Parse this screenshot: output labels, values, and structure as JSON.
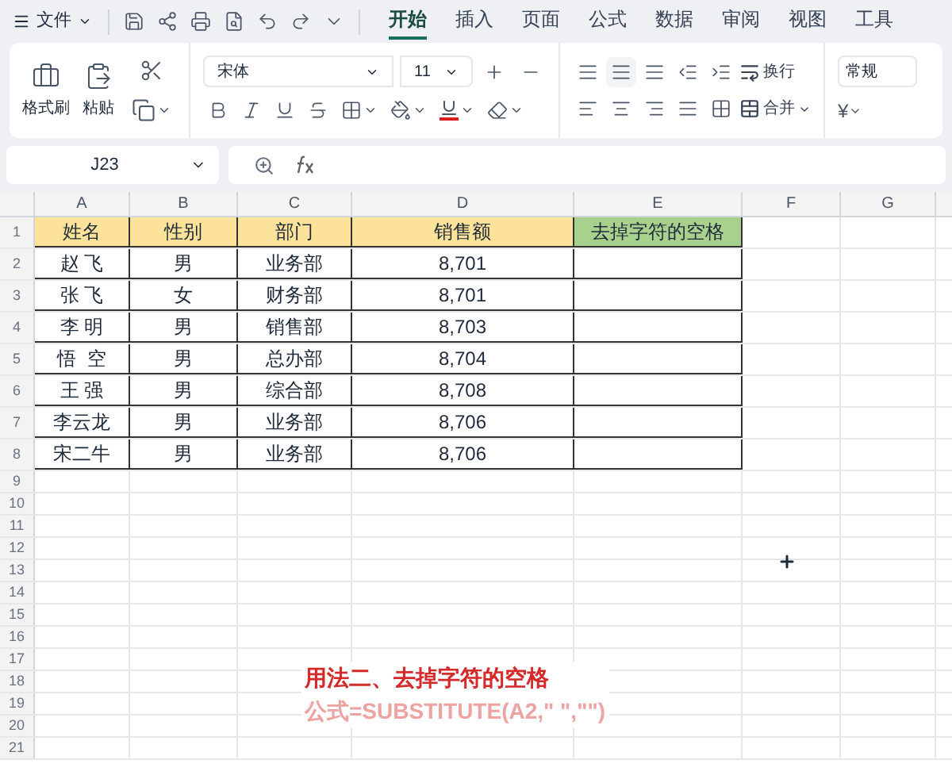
{
  "menu": {
    "file_label": "文件",
    "tabs": [
      {
        "label": "开始",
        "selected": true
      },
      {
        "label": "插入",
        "selected": false
      },
      {
        "label": "页面",
        "selected": false
      },
      {
        "label": "公式",
        "selected": false
      },
      {
        "label": "数据",
        "selected": false
      },
      {
        "label": "审阅",
        "selected": false
      },
      {
        "label": "视图",
        "selected": false
      },
      {
        "label": "工具",
        "selected": false
      }
    ]
  },
  "ribbon": {
    "format_painter": "格式刷",
    "paste": "粘贴",
    "font_name": "宋体",
    "font_size": "11",
    "wrap": "换行",
    "merge": "合并",
    "number_format": "常规",
    "currency_symbol": "¥"
  },
  "formula_bar": {
    "cell_ref": "J23"
  },
  "sheet": {
    "columns": [
      "A",
      "B",
      "C",
      "D",
      "E",
      "F",
      "G"
    ],
    "header": [
      "姓名",
      "性别",
      "部门",
      "销售额",
      "去掉字符的空格"
    ],
    "rows": [
      [
        "赵 飞",
        "男",
        "业务部",
        "8,701"
      ],
      [
        "张 飞",
        "女",
        "财务部",
        "8,701"
      ],
      [
        "李 明",
        "男",
        "销售部",
        "8,703"
      ],
      [
        "悟  空",
        "男",
        "总办部",
        "8,704"
      ],
      [
        "王 强",
        "男",
        "综合部",
        "8,708"
      ],
      [
        "李云龙",
        "男",
        "业务部",
        "8,706"
      ],
      [
        "宋二牛",
        "男",
        "业务部",
        "8,706"
      ]
    ],
    "row_numbers": [
      "1",
      "2",
      "3",
      "4",
      "5",
      "6",
      "7",
      "8",
      "9",
      "10",
      "11",
      "12",
      "13",
      "14",
      "15",
      "16",
      "17",
      "18",
      "19",
      "20",
      "21"
    ]
  },
  "annotation": {
    "title": "用法二、去掉字符的空格",
    "formula": "公式=SUBSTITUTE(A2,\" \",\"\")"
  }
}
